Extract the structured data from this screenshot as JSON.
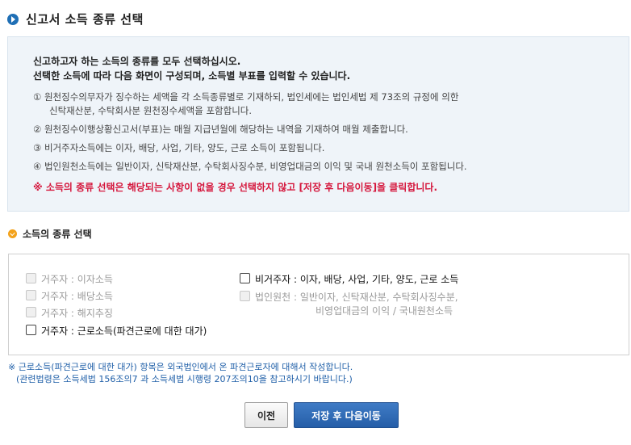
{
  "page": {
    "title": "신고서 소득 종류 선택"
  },
  "info": {
    "heading_line1": "신고하고자 하는 소득의 종류를 모두 선택하십시오.",
    "heading_line2": "선택한 소득에 따라 다음 화면이 구성되며, 소득별 부표를 입력할 수 있습니다.",
    "items": [
      "① 원천징수의무자가 징수하는 세액을 각 소득종류별로 기재하되, 법인세에는 법인세법 제 73조의 규정에 의한",
      "신탁재산분, 수탁회사분 원천징수세액을 포함합니다.",
      "② 원천징수이행상황신고서(부표)는 매월 지급년월에 해당하는 내역을 기재하여 매월 제출합니다.",
      "③ 비거주자소득에는 이자, 배당, 사업, 기타, 양도, 근로 소득이 포함됩니다.",
      "④ 법인원천소득에는 일반이자, 신탁재산분, 수탁회사징수분, 비영업대금의 이익 및 국내 원천소득이 포함됩니다."
    ],
    "warning": "※ 소득의 종류 선택은 해당되는 사항이 없을 경우 선택하지 않고 [저장 후 다음이동]을 클릭합니다."
  },
  "section": {
    "title": "소득의 종류 선택"
  },
  "options": {
    "resident_interest": "거주자 : 이자소득",
    "resident_dividend": "거주자 : 배당소득",
    "resident_termination": "거주자 : 해지추징",
    "resident_labor": "거주자 : 근로소득(파견근로에 대한 대가)",
    "nonresident": "비거주자 : 이자, 배당, 사업, 기타, 양도, 근로 소득",
    "corporate_line1": "법인원천 : 일반이자, 신탁재산분, 수탁회사징수분,",
    "corporate_line2": "비영업대금의 이익 / 국내원천소득"
  },
  "note": {
    "line1": "※ 근로소득(파견근로에 대한 대가) 항목은 외국법인에서 온 파견근로자에 대해서 작성합니다.",
    "line2": "(관련법령은 소득세법 156조의7 과 소득세법 시행령 207조의10을 참고하시기 바랍니다.)"
  },
  "buttons": {
    "prev": "이전",
    "save_next": "저장 후 다음이동"
  },
  "colors": {
    "accent_blue": "#1f6fb5",
    "warning_red": "#d5163c",
    "note_blue": "#1f5fa8",
    "section_orange": "#f3a21b"
  }
}
